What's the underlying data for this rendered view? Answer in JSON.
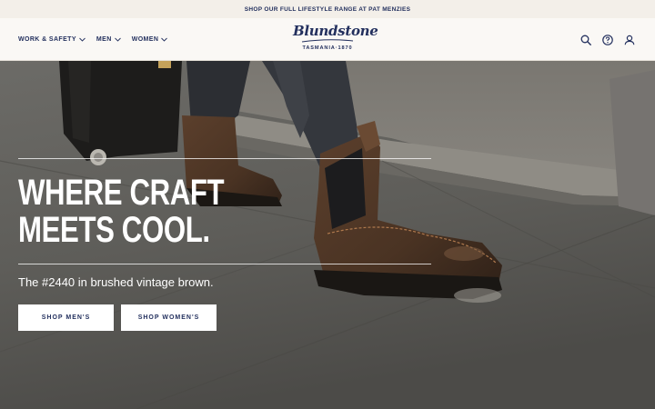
{
  "announcement": {
    "text": "SHOP OUR FULL LIFESTYLE RANGE AT PAT MENZIES"
  },
  "nav": {
    "items": [
      {
        "label": "WORK & SAFETY"
      },
      {
        "label": "MEN"
      },
      {
        "label": "WOMEN"
      }
    ]
  },
  "logo": {
    "brand": "Blundstone",
    "tagline": "TASMANIA·1870"
  },
  "header_icons": [
    "search-icon",
    "help-icon",
    "account-icon"
  ],
  "hero": {
    "headline_line1": "WHERE CRAFT",
    "headline_line2": "MEETS COOL.",
    "subtitle": "The #2440 in brushed vintage brown.",
    "buttons": {
      "men": "SHOP MEN'S",
      "women": "SHOP WOMEN'S"
    }
  },
  "colors": {
    "brand_navy": "#23305e",
    "announcement_bg": "#f3efe9",
    "header_bg": "#faf8f5",
    "boot_brown": "#4a3425"
  }
}
